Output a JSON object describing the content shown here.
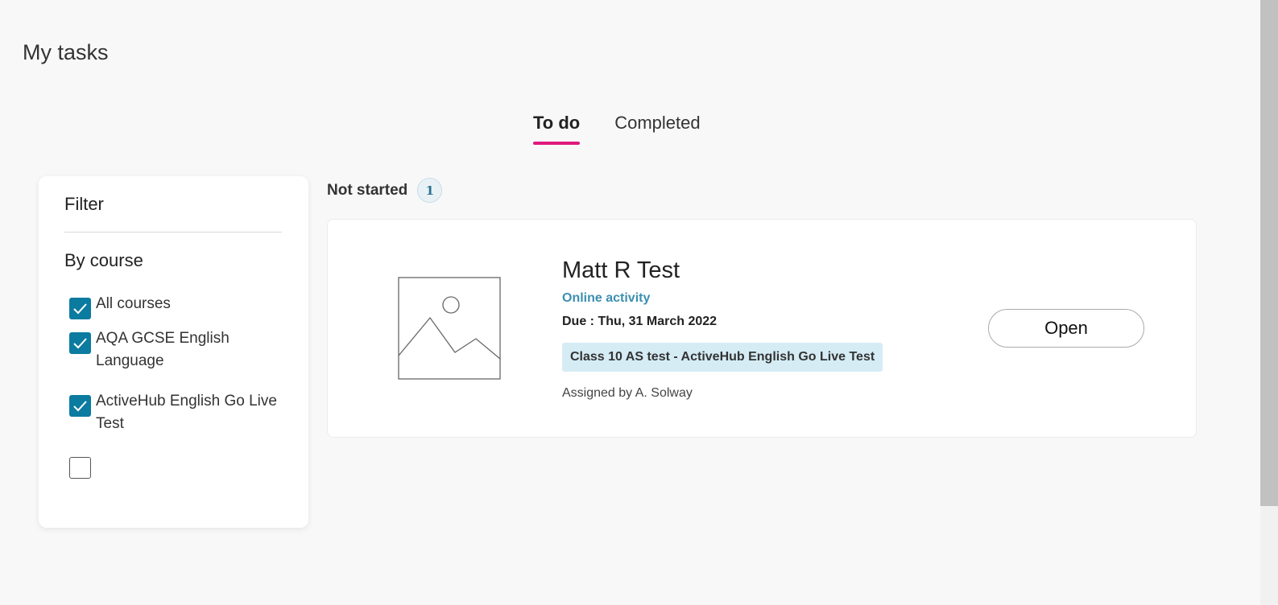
{
  "page": {
    "title": "My tasks"
  },
  "tabs": [
    {
      "label": "To do",
      "active": true
    },
    {
      "label": "Completed",
      "active": false
    }
  ],
  "filter": {
    "title": "Filter",
    "section_label": "By course",
    "options": [
      {
        "label": "All courses",
        "checked": true
      },
      {
        "label": "AQA GCSE English Language",
        "checked": true
      },
      {
        "label": "ActiveHub English Go Live Test",
        "checked": true
      },
      {
        "label": "",
        "checked": false
      }
    ]
  },
  "section": {
    "label": "Not started",
    "count": "1"
  },
  "task": {
    "thumbnail_icon": "image-placeholder-icon",
    "title": "Matt R Test",
    "type": "Online activity",
    "due": "Due : Thu, 31 March 2022",
    "tag": "Class 10 AS test - ActiveHub English Go Live Test",
    "assigned": "Assigned by A. Solway",
    "open_label": "Open"
  },
  "colors": {
    "accent": "#e0197d",
    "checkbox": "#0b7ba0",
    "link": "#3b8fb0",
    "tag_bg": "#d5ecf5"
  }
}
